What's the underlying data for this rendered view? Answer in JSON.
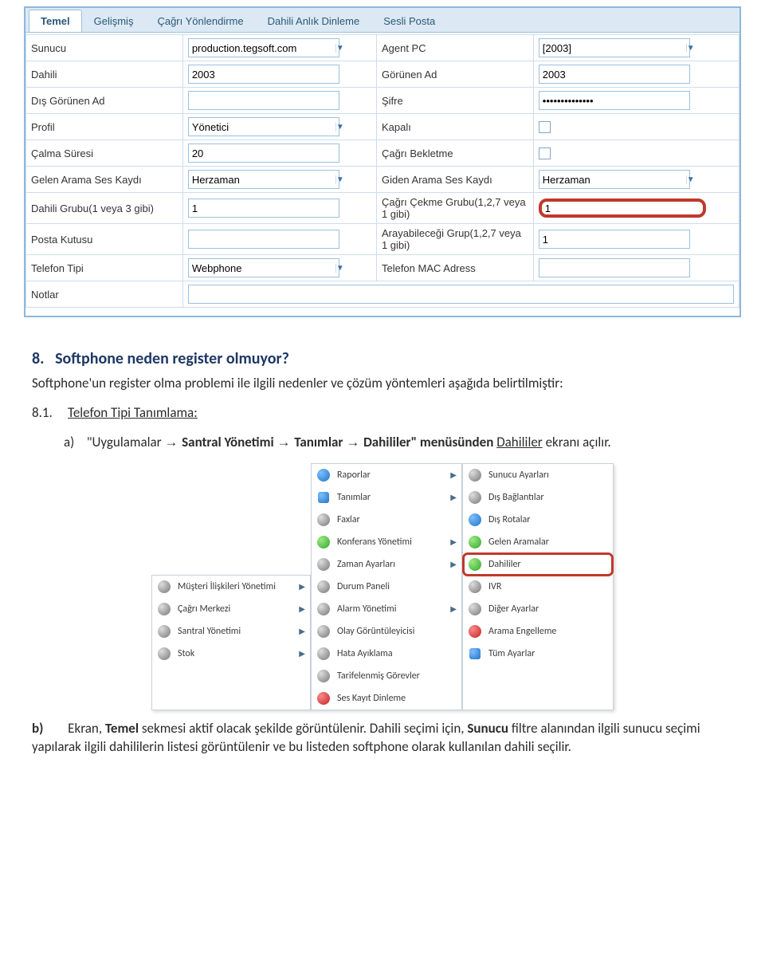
{
  "tabs": [
    "Temel",
    "Gelişmiş",
    "Çağrı Yönlendirme",
    "Dahili Anlık Dinleme",
    "Sesli Posta"
  ],
  "active_tab": 0,
  "form": {
    "sunucu_lbl": "Sunucu",
    "sunucu_val": "production.tegsoft.com",
    "agentpc_lbl": "Agent PC",
    "agentpc_val": "[2003]",
    "dahili_lbl": "Dahili",
    "dahili_val": "2003",
    "gorunenad_lbl": "Görünen Ad",
    "gorunenad_val": "2003",
    "disgorunen_lbl": "Dış Görünen Ad",
    "disgorunen_val": "",
    "sifre_lbl": "Şifre",
    "sifre_val": "••••••••••••••",
    "profil_lbl": "Profil",
    "profil_val": "Yönetici",
    "kapali_lbl": "Kapalı",
    "calma_lbl": "Çalma Süresi",
    "calma_val": "20",
    "cagribek_lbl": "Çağrı Bekletme",
    "gelenses_lbl": "Gelen Arama Ses Kaydı",
    "gelenses_val": "Herzaman",
    "gidenses_lbl": "Giden Arama Ses Kaydı",
    "gidenses_val": "Herzaman",
    "dahiligrp_lbl": "Dahili Grubu(1 veya 3 gibi)",
    "dahiligrp_val": "1",
    "cagricek_lbl": "Çağrı Çekme Grubu(1,2,7 veya 1 gibi)",
    "cagricek_val": "1",
    "posta_lbl": "Posta Kutusu",
    "posta_val": "",
    "arayagrp_lbl": "Arayabileceği Grup(1,2,7 veya 1 gibi)",
    "arayagrp_val": "1",
    "telefontipi_lbl": "Telefon Tipi",
    "telefontipi_val": "Webphone",
    "telmac_lbl": "Telefon MAC Adress",
    "telmac_val": "",
    "notlar_lbl": "Notlar",
    "notlar_val": ""
  },
  "doc": {
    "h2_num": "8.",
    "h2_txt": "Softphone neden register olmuyor?",
    "intro": "Softphone'un register olma problemi ile ilgili nedenler ve çözüm yöntemleri aşağıda belirtilmiştir:",
    "sub_num": "8.1.",
    "sub_txt": "Telefon Tipi Tanımlama:",
    "item_a_lead": "a)",
    "item_a_1": "\"Uygulamalar",
    "item_a_2": "Santral Yönetimi",
    "item_a_3": "Tanımlar",
    "item_a_4": "Dahililer\" menüsünden",
    "item_a_5": "Dahililer",
    "item_a_6": "ekranı açılır.",
    "item_b_lead": "b)",
    "item_b_txt": "Ekran, Temel sekmesi aktif olacak şekilde görüntülenir. Dahili seçimi için, Sunucu filtre alanından ilgili sunucu seçimi yapılarak ilgili dahililerin listesi görüntülenir ve bu listeden softphone olarak kullanılan dahili seçilir.",
    "bold_temel": "Temel",
    "bold_sunucu": "Sunucu"
  },
  "menuA": [
    {
      "label": "Müşteri İlişkileri Yönetimi",
      "exp": true
    },
    {
      "label": "Çağrı Merkezi",
      "exp": true
    },
    {
      "label": "Santral Yönetimi",
      "exp": true
    },
    {
      "label": "Stok",
      "exp": true
    }
  ],
  "menuB": [
    {
      "label": "Raporlar",
      "exp": true,
      "icon": "blue"
    },
    {
      "label": "Tanımlar",
      "exp": true,
      "icon": "dbl"
    },
    {
      "label": "Faxlar",
      "exp": false,
      "icon": "gray"
    },
    {
      "label": "Konferans Yönetimi",
      "exp": true,
      "icon": "green"
    },
    {
      "label": "Zaman Ayarları",
      "exp": true,
      "icon": "gray"
    },
    {
      "label": "Durum Paneli",
      "exp": false,
      "icon": "gray"
    },
    {
      "label": "Alarm Yönetimi",
      "exp": true,
      "icon": "gray"
    },
    {
      "label": "Olay Görüntüleyicisi",
      "exp": false,
      "icon": "gray"
    },
    {
      "label": "Hata Ayıklama",
      "exp": false,
      "icon": "gray"
    },
    {
      "label": "Tarifelenmiş Görevler",
      "exp": false,
      "icon": "gray"
    },
    {
      "label": "Ses Kayıt Dinleme",
      "exp": false,
      "icon": "red"
    }
  ],
  "menuC": [
    {
      "label": "Sunucu Ayarları",
      "icon": "gray"
    },
    {
      "label": "Dış Bağlantılar",
      "icon": "gray"
    },
    {
      "label": "Dış Rotalar",
      "icon": "blue"
    },
    {
      "label": "Gelen Aramalar",
      "icon": "green"
    },
    {
      "label": "Dahililer",
      "icon": "green",
      "hl": true
    },
    {
      "label": "IVR",
      "icon": "gray"
    },
    {
      "label": "Diğer Ayarlar",
      "icon": "gray"
    },
    {
      "label": "Arama Engelleme",
      "icon": "red"
    },
    {
      "label": "Tüm Ayarlar",
      "icon": "dbl"
    }
  ]
}
